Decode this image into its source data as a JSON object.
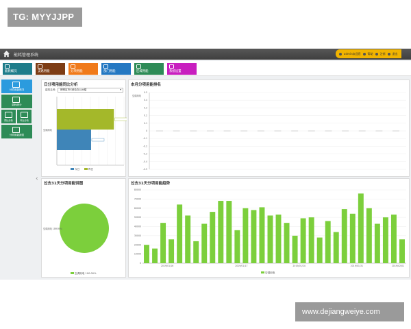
{
  "watermarks": {
    "top": "TG: MYYJJPP",
    "bottom": "www.dejiangweiye.com"
  },
  "app": {
    "title": "能耗管理系统"
  },
  "user_pill": {
    "user": "admin欢迎您",
    "b2": "帮助",
    "b3": "注销",
    "b4": "退出"
  },
  "colors": {
    "titlebar": "#474747",
    "pill": "#f2b400",
    "green": "#2e8b57",
    "blue": "#2b9bde",
    "bar_green": "#7ccf3c",
    "olive": "#a4b82a",
    "steel": "#3f85b8"
  },
  "modules": [
    {
      "label": "能耗概况",
      "color": "#1e7c8a",
      "icon": "overview-icon"
    },
    {
      "label": "支路用能",
      "color": "#7d3c14",
      "icon": "branch-icon"
    },
    {
      "label": "分项用能",
      "color": "#f07a1a",
      "icon": "item-icon"
    },
    {
      "label": "部门用能",
      "color": "#2478c2",
      "icon": "department-icon"
    },
    {
      "label": "区域用能",
      "color": "#2e8b57",
      "icon": "region-icon"
    },
    {
      "label": "系统设置",
      "color": "#c81fbf",
      "icon": "settings-icon"
    }
  ],
  "sidebar": {
    "items": [
      {
        "label": "分项用能概况",
        "active": true
      },
      {
        "label": "能耗统计"
      },
      {
        "label": "同比分析"
      },
      {
        "label": "环比分析"
      },
      {
        "label": "分项用能报表"
      }
    ]
  },
  "panels": {
    "p1": {
      "title": "日分项用能同比分析",
      "select_label": "建筑名称:",
      "select_value": "碑林区市X综合办公大楼",
      "legend": [
        "今日",
        "昨日"
      ],
      "category": "空调用电"
    },
    "p2": {
      "title": "本月分项用能排名",
      "ylabel": "空调用电"
    },
    "p3": {
      "title": "过去31天分项用能饼图",
      "slice_label": "空调用电 100.00%",
      "legend": "空调用电 100.00%"
    },
    "p4": {
      "title": "过去31天分项用能趋势",
      "legend": "空调用电"
    }
  },
  "chart_data": [
    {
      "type": "bar",
      "orientation": "horizontal",
      "categories": [
        "空调用电"
      ],
      "series": [
        {
          "name": "今日",
          "values": [
            0.6
          ]
        },
        {
          "name": "昨日",
          "values": [
            1.0
          ]
        }
      ]
    },
    {
      "type": "line",
      "x": [
        "",
        "",
        "",
        "",
        "",
        "",
        "",
        "",
        "",
        "",
        "",
        "",
        "",
        "",
        ""
      ],
      "ylabel": "空调用电",
      "yticks": [
        "0.5",
        "0.4",
        "0.3",
        "0.2",
        "0.1",
        "0",
        "-0.1",
        "-0.2",
        "-0.3",
        "-0.4",
        "-0.5"
      ],
      "ylim": [
        -0.5,
        0.5
      ],
      "series": [
        {
          "values": [
            0,
            0,
            0,
            0,
            0,
            0,
            0,
            0,
            0,
            0,
            0,
            0,
            0,
            0,
            0
          ]
        }
      ]
    },
    {
      "type": "pie",
      "series": [
        {
          "name": "空调用电",
          "values": [
            100
          ]
        }
      ]
    },
    {
      "type": "bar",
      "ylim": [
        0,
        80000
      ],
      "yticks": [
        "80000",
        "70000",
        "60000",
        "50000",
        "40000",
        "30000",
        "20000",
        "10000",
        "0"
      ],
      "xticks": [
        "2019/01/16",
        "2019/01/17",
        "2019/01/24",
        "2019/01/31",
        "2019/02/01"
      ],
      "series": [
        {
          "name": "空调用电",
          "values": [
            20000,
            16000,
            44000,
            26000,
            64000,
            52000,
            24000,
            43000,
            56000,
            68000,
            68000,
            36000,
            60000,
            58000,
            61000,
            52000,
            53000,
            44000,
            30000,
            49000,
            50000,
            28000,
            46000,
            34000,
            59000,
            54000,
            76000,
            60000,
            43000,
            50000,
            53000,
            26000
          ]
        }
      ]
    }
  ]
}
